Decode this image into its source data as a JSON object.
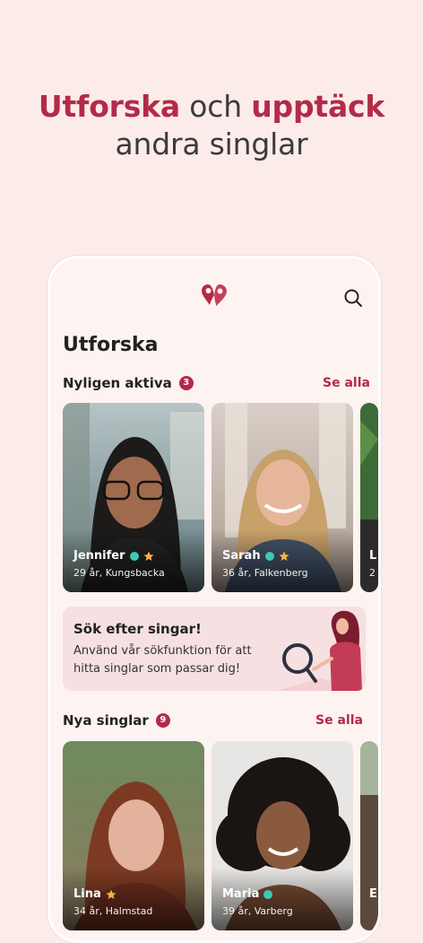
{
  "headline": {
    "accent_1": "Utforska",
    "middle": " och ",
    "accent_2": "upptäck",
    "line_2": "andra singlar"
  },
  "app": {
    "page_title": "Utforska",
    "recently_active": {
      "label": "Nyligen aktiva",
      "count": "3",
      "see_all": "Se alla",
      "profiles": [
        {
          "name": "Jennifer",
          "meta": "29 år, Kungsbacka",
          "online": true,
          "premium": true
        },
        {
          "name": "Sarah",
          "meta": "36 år, Falkenberg",
          "online": true,
          "premium": true
        },
        {
          "name": "L",
          "meta": "2"
        }
      ]
    },
    "promo": {
      "title": "Sök efter singar!",
      "text": "Använd vår sökfunktion för att hitta singlar som passar dig!"
    },
    "new_singles": {
      "label": "Nya singlar",
      "count": "9",
      "see_all": "Se alla",
      "profiles": [
        {
          "name": "Lina",
          "meta": "34 år, Halmstad",
          "online": false,
          "premium": true
        },
        {
          "name": "Maria",
          "meta": "39 år, Varberg",
          "online": true,
          "premium": false
        },
        {
          "name": "E",
          "meta": ""
        }
      ]
    },
    "icons": {
      "logo": "heart-pin-logo-icon",
      "search": "search-icon",
      "online": "online-dot-icon",
      "premium": "star-badge-icon"
    },
    "colors": {
      "accent": "#b42a48",
      "background": "#fbecea",
      "online": "#3ec9b2"
    }
  }
}
